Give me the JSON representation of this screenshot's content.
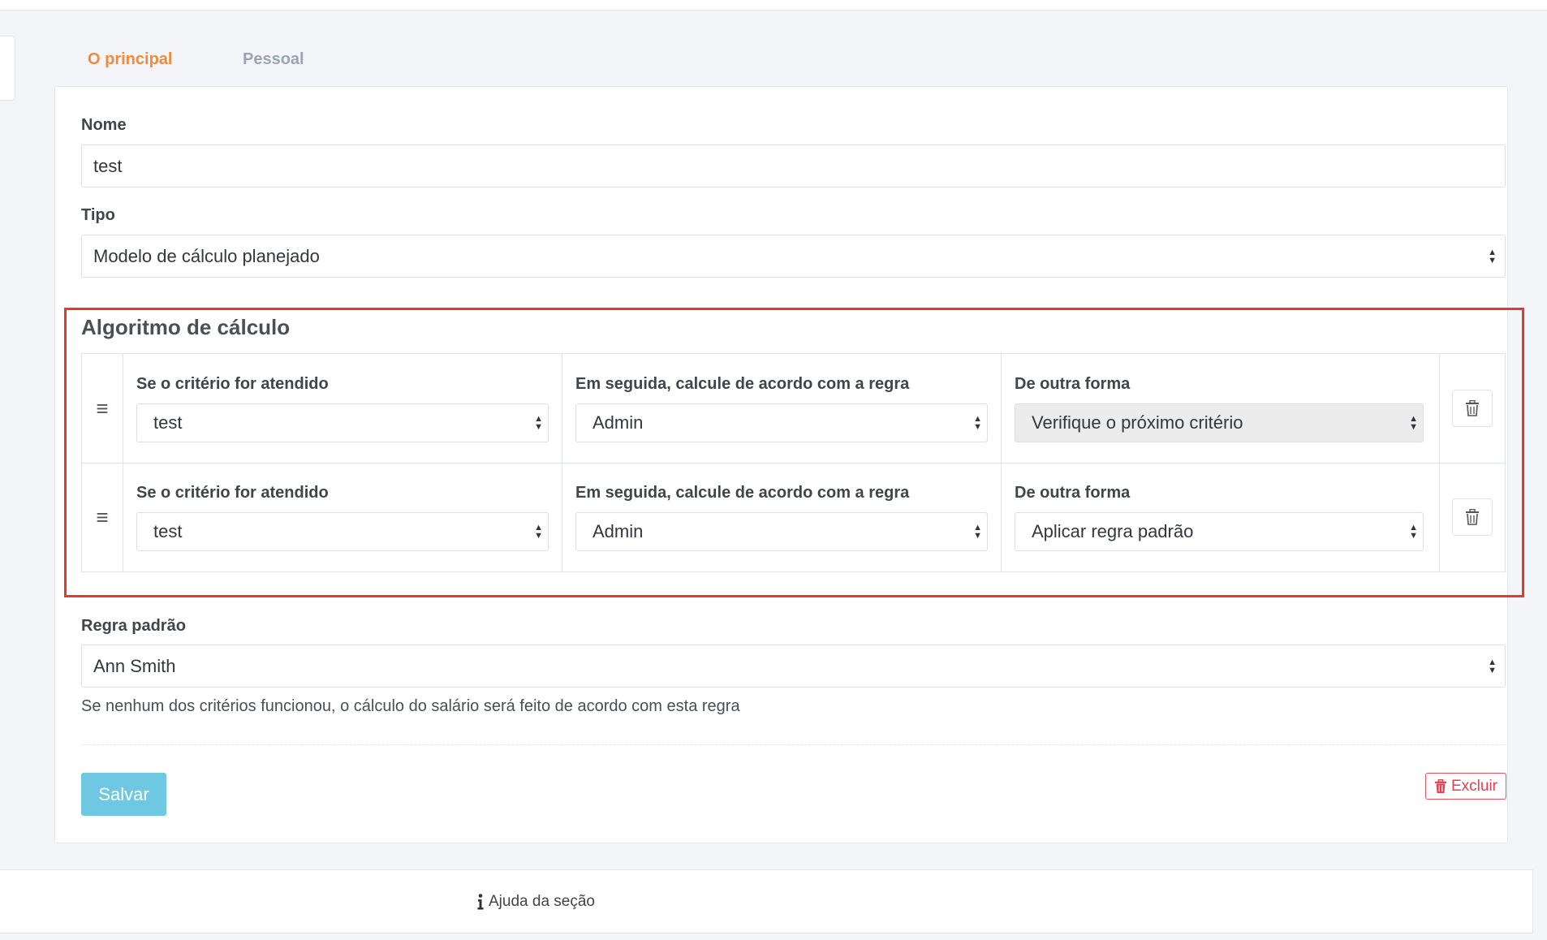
{
  "tabs": [
    {
      "label": "O principal",
      "active": true
    },
    {
      "label": "Pessoal",
      "active": false
    }
  ],
  "form": {
    "name_label": "Nome",
    "name_value": "test",
    "type_label": "Tipo",
    "type_value": "Modelo de cálculo planejado"
  },
  "algorithm": {
    "title": "Algoritmo de cálculo",
    "rows": [
      {
        "criterion_label": "Se o critério for atendido",
        "criterion_value": "test",
        "rule_label": "Em seguida, calcule de acordo com a regra",
        "rule_value": "Admin",
        "otherwise_label": "De outra forma",
        "otherwise_value": "Verifique o próximo critério",
        "otherwise_disabled": true
      },
      {
        "criterion_label": "Se o critério for atendido",
        "criterion_value": "test",
        "rule_label": "Em seguida, calcule de acordo com a regra",
        "rule_value": "Admin",
        "otherwise_label": "De outra forma",
        "otherwise_value": "Aplicar regra padrão",
        "otherwise_disabled": false
      }
    ]
  },
  "default_rule": {
    "label": "Regra padrão",
    "value": "Ann Smith",
    "help": "Se nenhum dos critérios funcionou, o cálculo do salário será feito de acordo com esta regra"
  },
  "actions": {
    "save_label": "Salvar",
    "delete_label": "Excluir"
  },
  "footer": {
    "help_label": "Ajuda da seção"
  },
  "colors": {
    "accent_tab": "#ef8a3e",
    "save_button": "#6fc8e2",
    "delete_button": "#e04050",
    "highlight_border": "#e33a2c"
  },
  "icons": {
    "drag": "drag-handle-icon",
    "trash": "trash-icon",
    "info": "info-icon",
    "select_arrows": "select-arrows-icon"
  }
}
